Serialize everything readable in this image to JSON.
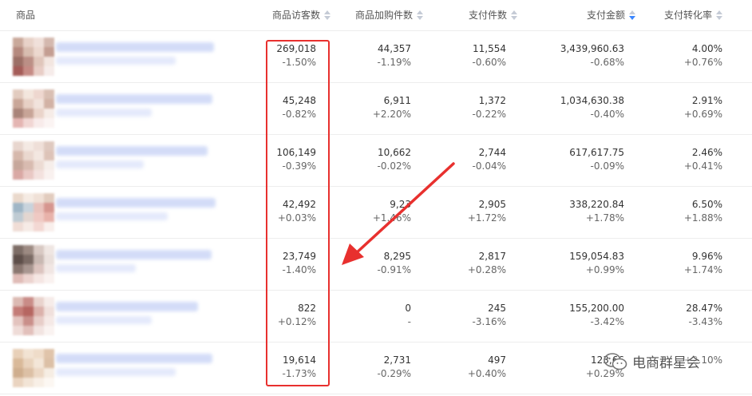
{
  "headers": [
    {
      "label": "商品",
      "sortable": false
    },
    {
      "label": "商品访客数",
      "sortable": true,
      "active": false
    },
    {
      "label": "商品加购件数",
      "sortable": true,
      "active": false
    },
    {
      "label": "支付件数",
      "sortable": true,
      "active": false
    },
    {
      "label": "支付金额",
      "sortable": true,
      "active": true
    },
    {
      "label": "支付转化率",
      "sortable": true,
      "active": false
    }
  ],
  "rows": [
    {
      "visitors": {
        "value": "269,018",
        "change": "-1.50%"
      },
      "cart": {
        "value": "44,357",
        "change": "-1.19%"
      },
      "pay_qty": {
        "value": "11,554",
        "change": "-0.60%"
      },
      "pay_amount": {
        "value": "3,439,960.63",
        "change": "-0.68%"
      },
      "conv": {
        "value": "4.00%",
        "change": "+0.76%"
      }
    },
    {
      "visitors": {
        "value": "45,248",
        "change": "-0.82%"
      },
      "cart": {
        "value": "6,911",
        "change": "+2.20%"
      },
      "pay_qty": {
        "value": "1,372",
        "change": "-0.22%"
      },
      "pay_amount": {
        "value": "1,034,630.38",
        "change": "-0.40%"
      },
      "conv": {
        "value": "2.91%",
        "change": "+0.69%"
      }
    },
    {
      "visitors": {
        "value": "106,149",
        "change": "-0.39%"
      },
      "cart": {
        "value": "10,662",
        "change": "-0.02%"
      },
      "pay_qty": {
        "value": "2,744",
        "change": "-0.04%"
      },
      "pay_amount": {
        "value": "617,617.75",
        "change": "-0.09%"
      },
      "conv": {
        "value": "2.46%",
        "change": "+0.41%"
      }
    },
    {
      "visitors": {
        "value": "42,492",
        "change": "+0.03%"
      },
      "cart": {
        "value": "9,23",
        "change": "+1.46%"
      },
      "pay_qty": {
        "value": "2,905",
        "change": "+1.72%"
      },
      "pay_amount": {
        "value": "338,220.84",
        "change": "+1.78%"
      },
      "conv": {
        "value": "6.50%",
        "change": "+1.88%"
      }
    },
    {
      "visitors": {
        "value": "23,749",
        "change": "-1.40%"
      },
      "cart": {
        "value": "8,295",
        "change": "-0.91%"
      },
      "pay_qty": {
        "value": "2,817",
        "change": "+0.28%"
      },
      "pay_amount": {
        "value": "159,054.83",
        "change": "+0.99%"
      },
      "conv": {
        "value": "9.96%",
        "change": "+1.74%"
      }
    },
    {
      "visitors": {
        "value": "822",
        "change": "+0.12%"
      },
      "cart": {
        "value": "0",
        "change": "-"
      },
      "pay_qty": {
        "value": "245",
        "change": "-3.16%"
      },
      "pay_amount": {
        "value": "155,200.00",
        "change": "-3.42%"
      },
      "conv": {
        "value": "28.47%",
        "change": "-3.43%"
      }
    },
    {
      "visitors": {
        "value": "19,614",
        "change": "-1.73%"
      },
      "cart": {
        "value": "2,731",
        "change": "-0.29%"
      },
      "pay_qty": {
        "value": "497",
        "change": "+0.40%"
      },
      "pay_amount": {
        "value": "123,66",
        "change": "+0.29%"
      },
      "conv": {
        "value": "",
        "change": "+2.10%"
      }
    }
  ],
  "watermark": {
    "text": "电商群星会",
    "icon": "wechat-icon"
  },
  "colors": {
    "highlight": "#e8302e",
    "sort_active": "#3a86ff",
    "sort_idle": "#c5cbd6"
  }
}
